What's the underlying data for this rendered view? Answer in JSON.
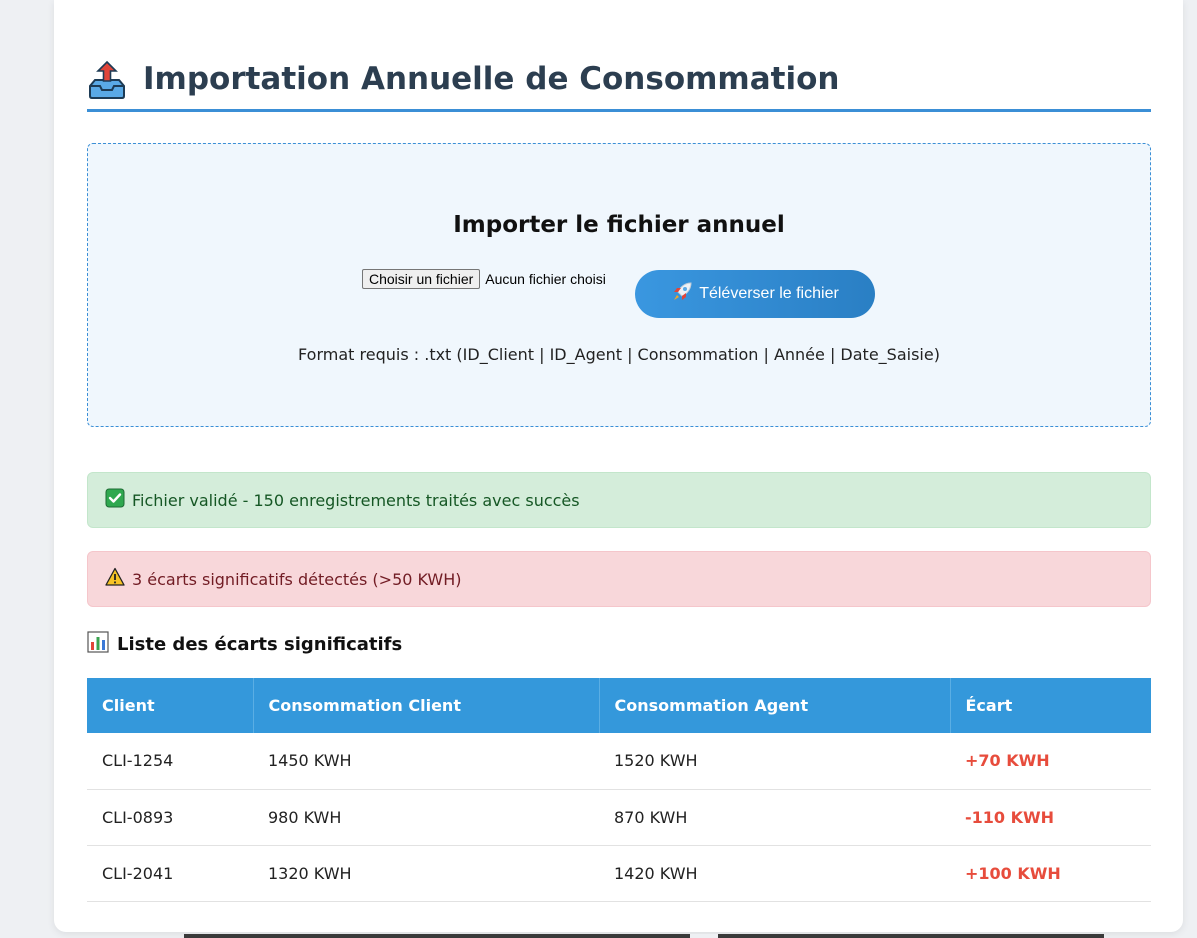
{
  "header": {
    "title": "Importation Annuelle de Consommation",
    "icon": "outbox-tray-icon"
  },
  "upload": {
    "heading": "Importer le fichier annuel",
    "choose_label": "Choisir un fichier",
    "no_file_label": "Aucun fichier choisi",
    "submit_label": "Téléverser le fichier",
    "submit_icon": "rocket-icon",
    "format_hint": "Format requis : .txt (ID_Client | ID_Agent | Consommation | Année | Date_Saisie)"
  },
  "alerts": {
    "success": {
      "icon": "check-mark-icon",
      "text": "Fichier validé - 150 enregistrements traités avec succès",
      "color": "#155724"
    },
    "warning": {
      "icon": "warning-icon",
      "text": "3 écarts significatifs détectés (>50 KWH)",
      "color": "#721c24"
    }
  },
  "diffs": {
    "title": "Liste des écarts significatifs",
    "icon": "bar-chart-icon",
    "columns": [
      "Client",
      "Consommation Client",
      "Consommation Agent",
      "Écart"
    ],
    "rows": [
      {
        "client": "CLI-1254",
        "conso_client": "1450 KWH",
        "conso_agent": "1520 KWH",
        "ecart": "+70 KWH"
      },
      {
        "client": "CLI-0893",
        "conso_client": "980 KWH",
        "conso_agent": "870 KWH",
        "ecart": "-110 KWH"
      },
      {
        "client": "CLI-2041",
        "conso_client": "1320 KWH",
        "conso_agent": "1420 KWH",
        "ecart": "+100 KWH"
      }
    ]
  },
  "colors": {
    "accent": "#3498db",
    "title": "#2c3e50",
    "ecart": "#e74c3c"
  }
}
